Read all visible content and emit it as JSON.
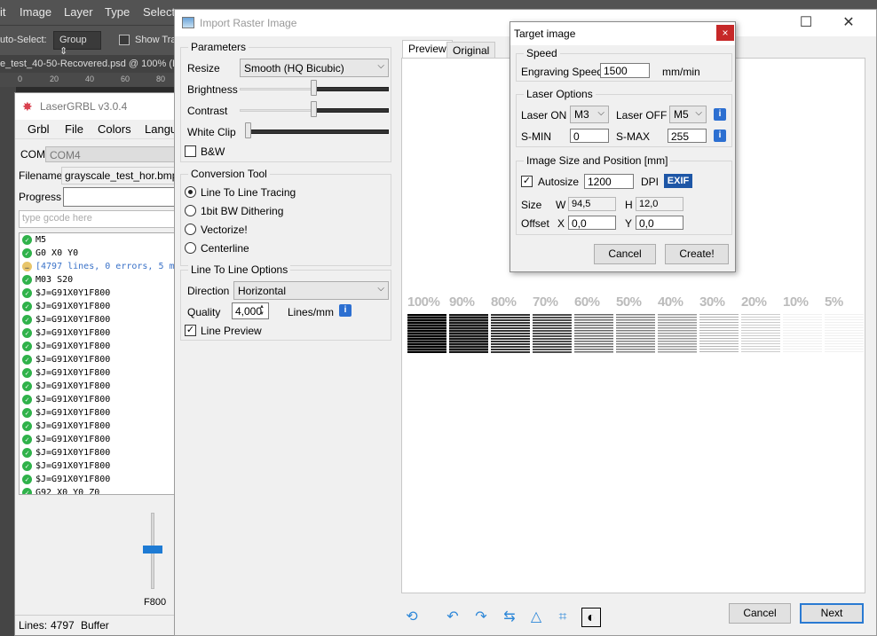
{
  "photoshop": {
    "menu": [
      "it",
      "Image",
      "Layer",
      "Type",
      "Select"
    ],
    "auto_select_label": "uto-Select:",
    "auto_select_value": "Group",
    "show_transform_label": "Show Tra",
    "doc_tab": "e_test_40-50-Recovered.psd @ 100% (E",
    "ruler": [
      "0",
      "20",
      "40",
      "60",
      "80"
    ]
  },
  "lasergrbl": {
    "title": "LaserGRBL v3.0.4",
    "menu": [
      "Grbl",
      "File",
      "Colors",
      "Langu"
    ],
    "com_label": "COM",
    "com_value": "COM4",
    "filename_label": "Filename",
    "filename_value": "grayscale_test_hor.bmp",
    "progress_label": "Progress",
    "gcode_placeholder": "type gcode here",
    "log": [
      {
        "text": "M5",
        "kind": "ok"
      },
      {
        "text": "G0 X0 Y0",
        "kind": "ok"
      },
      {
        "text": "[4797 lines, 0 errors, 5 m",
        "kind": "info"
      },
      {
        "text": "M03 S20",
        "kind": "ok"
      },
      {
        "text": "$J=G91X0Y1F800",
        "kind": "ok"
      },
      {
        "text": "$J=G91X0Y1F800",
        "kind": "ok"
      },
      {
        "text": "$J=G91X0Y1F800",
        "kind": "ok"
      },
      {
        "text": "$J=G91X0Y1F800",
        "kind": "ok"
      },
      {
        "text": "$J=G91X0Y1F800",
        "kind": "ok"
      },
      {
        "text": "$J=G91X0Y1F800",
        "kind": "ok"
      },
      {
        "text": "$J=G91X0Y1F800",
        "kind": "ok"
      },
      {
        "text": "$J=G91X0Y1F800",
        "kind": "ok"
      },
      {
        "text": "$J=G91X0Y1F800",
        "kind": "ok"
      },
      {
        "text": "$J=G91X0Y1F800",
        "kind": "ok"
      },
      {
        "text": "$J=G91X0Y1F800",
        "kind": "ok"
      },
      {
        "text": "$J=G91X0Y1F800",
        "kind": "ok"
      },
      {
        "text": "$J=G91X0Y1F800",
        "kind": "ok"
      },
      {
        "text": "$J=G91X0Y1F800",
        "kind": "ok"
      },
      {
        "text": "$J=G91X0Y1F800",
        "kind": "ok"
      },
      {
        "text": "G92 X0 Y0 Z0",
        "kind": "ok"
      }
    ],
    "jog_speed": "F800",
    "lines_label": "Lines:",
    "lines_value": "4797",
    "buffer_label": "Buffer"
  },
  "import": {
    "title": "Import Raster Image",
    "parameters": {
      "title": "Parameters",
      "resize_label": "Resize",
      "resize_value": "Smooth (HQ Bicubic)",
      "brightness_label": "Brightness",
      "brightness_level": 0.5,
      "contrast_label": "Contrast",
      "contrast_level": 0.5,
      "whiteclip_label": "White Clip",
      "whiteclip_level": 0.05,
      "bw_label": "B&W",
      "bw_checked": false
    },
    "conversion": {
      "title": "Conversion Tool",
      "options": [
        "Line To Line Tracing",
        "1bit BW Dithering",
        "Vectorize!",
        "Centerline"
      ],
      "selected": 0
    },
    "line_options": {
      "title": "Line To Line Options",
      "direction_label": "Direction",
      "direction_value": "Horizontal",
      "quality_label": "Quality",
      "quality_value": "4,000",
      "quality_unit": "Lines/mm",
      "line_preview_label": "Line Preview",
      "line_preview_checked": true
    },
    "tabs": [
      "Preview",
      "Original"
    ],
    "active_tab": 0,
    "preview": {
      "percent_labels": [
        "100%",
        "90%",
        "80%",
        "70%",
        "60%",
        "50%",
        "40%",
        "30%",
        "20%",
        "10%",
        "5%"
      ],
      "densities": [
        1.0,
        0.9,
        0.8,
        0.7,
        0.6,
        0.5,
        0.4,
        0.3,
        0.2,
        0.1,
        0.05
      ]
    },
    "cancel_label": "Cancel",
    "next_label": "Next"
  },
  "target": {
    "title": "Target image",
    "close_icon": "×",
    "speed_title": "Speed",
    "engraving_speed_label": "Engraving Speed",
    "engraving_speed_value": "1500",
    "engraving_speed_unit": "mm/min",
    "laser_title": "Laser Options",
    "laser_on_label": "Laser ON",
    "laser_on_value": "M3",
    "laser_off_label": "Laser OFF",
    "laser_off_value": "M5",
    "smin_label": "S-MIN",
    "smin_value": "0",
    "smax_label": "S-MAX",
    "smax_value": "255",
    "size_title": "Image Size and Position [mm]",
    "autosize_label": "Autosize",
    "autosize_checked": true,
    "dpi_value": "1200",
    "dpi_label": "DPI",
    "exif_label": "EXIF",
    "size_label": "Size",
    "w_label": "W",
    "w_value": "94,5",
    "h_label": "H",
    "h_value": "12,0",
    "offset_label": "Offset",
    "x_label": "X",
    "x_value": "0,0",
    "y_label": "Y",
    "y_value": "0,0",
    "cancel_label": "Cancel",
    "create_label": "Create!"
  },
  "colors": {
    "accent": "#2a7ad2",
    "ok": "#2fb24a",
    "close_red": "#c62828",
    "exif_blue": "#1d56a6"
  }
}
